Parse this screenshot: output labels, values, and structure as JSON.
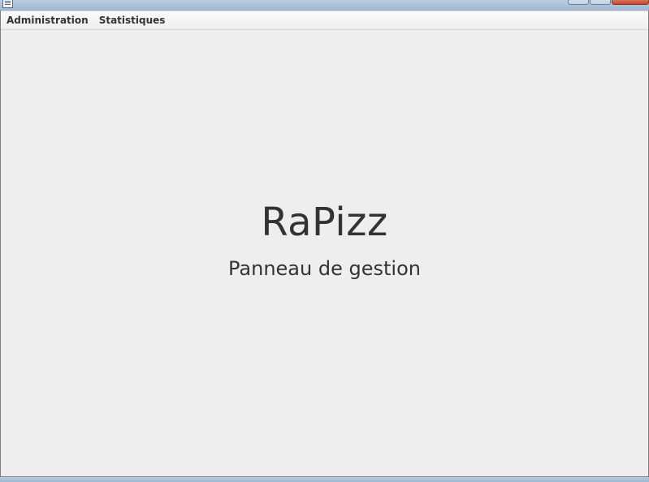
{
  "window": {
    "icon": "document-icon",
    "caption_buttons": [
      "minimize",
      "maximize",
      "close"
    ]
  },
  "menubar": {
    "items": [
      {
        "label": "Administration"
      },
      {
        "label": "Statistiques"
      }
    ]
  },
  "main": {
    "title": "RaPizz",
    "subtitle": "Panneau de gestion"
  },
  "colors": {
    "background": "#eeeeee",
    "text": "#333333",
    "close_button": "#c7452a"
  }
}
